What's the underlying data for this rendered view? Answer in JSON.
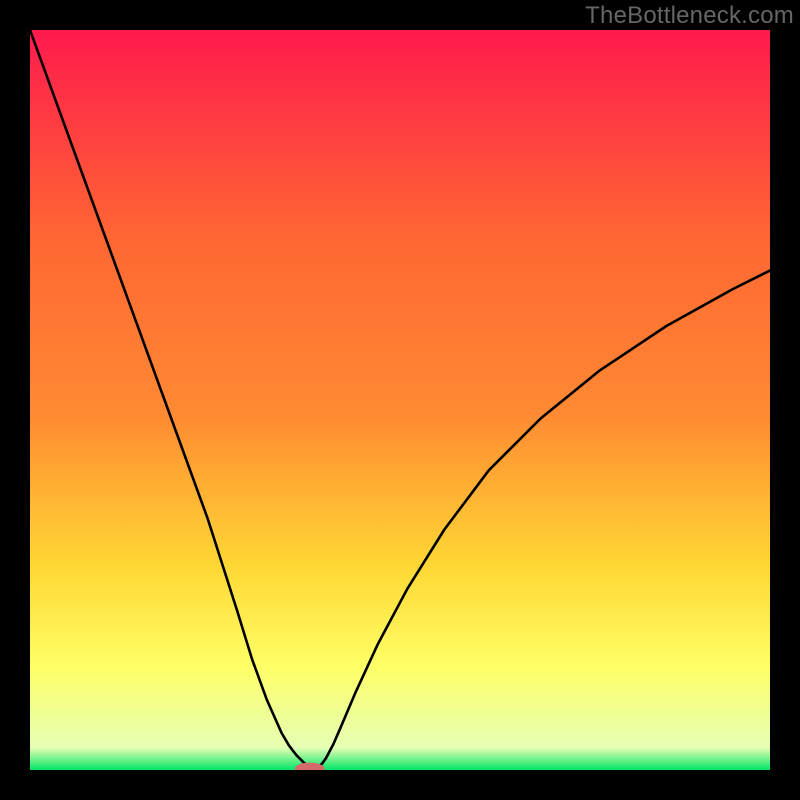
{
  "watermark": "TheBottleneck.com",
  "chart_data": {
    "type": "line",
    "title": "",
    "xlabel": "",
    "ylabel": "",
    "xlim": [
      0,
      1
    ],
    "ylim": [
      0,
      1
    ],
    "background_gradient": {
      "top": "#ff1a4d",
      "upper_mid": "#ff8a33",
      "mid": "#ffd633",
      "lower_mid": "#ffff66",
      "lower": "#e6ffb3",
      "bottom": "#00e566"
    },
    "series": [
      {
        "name": "curve",
        "x": [
          0.0,
          0.04,
          0.08,
          0.12,
          0.16,
          0.2,
          0.24,
          0.28,
          0.3,
          0.32,
          0.34,
          0.35,
          0.36,
          0.37,
          0.375,
          0.38,
          0.382,
          0.385,
          0.387,
          0.39,
          0.395,
          0.4,
          0.41,
          0.42,
          0.44,
          0.47,
          0.51,
          0.56,
          0.62,
          0.69,
          0.77,
          0.86,
          0.95,
          1.0
        ],
        "y": [
          1.0,
          0.89,
          0.78,
          0.67,
          0.56,
          0.45,
          0.34,
          0.215,
          0.15,
          0.095,
          0.05,
          0.033,
          0.02,
          0.01,
          0.006,
          0.003,
          0.002,
          0.002,
          0.002,
          0.004,
          0.009,
          0.016,
          0.035,
          0.058,
          0.105,
          0.17,
          0.245,
          0.325,
          0.405,
          0.475,
          0.54,
          0.6,
          0.65,
          0.675
        ]
      }
    ],
    "marker": {
      "x": 0.378,
      "y": 0.002,
      "rx": 0.02,
      "ry": 0.008,
      "color": "#d46a6a"
    }
  }
}
